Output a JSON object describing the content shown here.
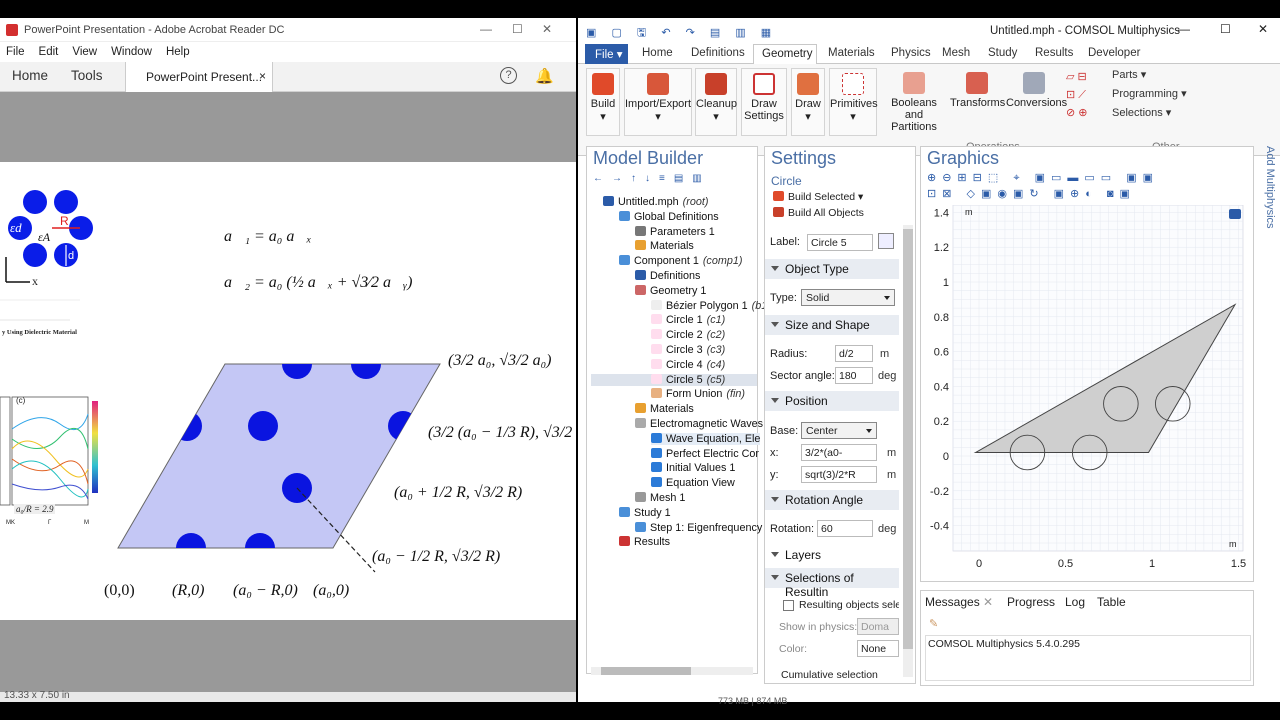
{
  "acrobat": {
    "window_title": "PowerPoint Presentation - Adobe Acrobat Reader DC",
    "menu": [
      "File",
      "Edit",
      "View",
      "Window",
      "Help"
    ],
    "nav": {
      "home": "Home",
      "tools": "Tools",
      "doc_tab": "PowerPoint Present...",
      "close": "×"
    },
    "slide": {
      "eq1": "a⃗₁ = a₀ a⃗ₓ",
      "eq2": "a⃗₂ = a₀ (½ a⃗ₓ + √3⁄2 a⃗ᵧ)",
      "label_top_right": "(3/2 a₀, √3/2 a₀)",
      "label_mid_right": "(3/2 (a₀ − 1/3 R), √3/2 (a₀",
      "label_center_right": "(a₀ + 1/2 R, √3/2 R)",
      "label_lower_right": "(a₀ − 1/2 R, √3/2 R)",
      "bottom_labels": [
        "(0,0)",
        "(R,0)",
        "(a₀ − R,0)",
        "(a₀,0)"
      ],
      "thumb_eps_d": "εd",
      "thumb_eps_a": "εA",
      "thumb_R": "R",
      "thumb_d": "d",
      "thumb_x": "x",
      "thumb_caption": "y Using Dielectric Material",
      "thumb_band_label": "(c)",
      "thumb_ratio": "a₀/R = 2.9",
      "thumb_axis": [
        "MK",
        "Γ",
        "M"
      ]
    },
    "status": "13.33 x 7.50 in"
  },
  "comsol": {
    "window_title": "Untitled.mph - COMSOL Multiphysics",
    "tabs": [
      "File ▾",
      "Home",
      "Definitions",
      "Geometry",
      "Materials",
      "Physics",
      "Mesh",
      "Study",
      "Results",
      "Developer"
    ],
    "ribbon": {
      "build": "Build",
      "import_export": "Import/Export",
      "cleanup": "Cleanup",
      "draw_settings": "Draw Settings",
      "draw": "Draw",
      "primitives": "Primitives",
      "booleans": "Booleans and Partitions",
      "transforms": "Transforms",
      "conversions": "Conversions",
      "operations": "Operations",
      "parts": "Parts ▾",
      "programming": "Programming ▾",
      "selections": "Selections ▾",
      "other": "Other"
    },
    "model_builder": {
      "title": "Model Builder",
      "items": [
        {
          "label": "Untitled.mph",
          "tag": "(root)"
        },
        {
          "label": "Global Definitions",
          "tag": ""
        },
        {
          "label": "Parameters 1",
          "tag": ""
        },
        {
          "label": "Materials",
          "tag": ""
        },
        {
          "label": "Component 1",
          "tag": "(comp1)"
        },
        {
          "label": "Definitions",
          "tag": ""
        },
        {
          "label": "Geometry 1",
          "tag": ""
        },
        {
          "label": "Bézier Polygon 1",
          "tag": "(b1)"
        },
        {
          "label": "Circle 1",
          "tag": "(c1)"
        },
        {
          "label": "Circle 2",
          "tag": "(c2)"
        },
        {
          "label": "Circle 3",
          "tag": "(c3)"
        },
        {
          "label": "Circle 4",
          "tag": "(c4)"
        },
        {
          "label": "Circle 5",
          "tag": "(c5)"
        },
        {
          "label": "Form Union",
          "tag": "(fin)"
        },
        {
          "label": "Materials",
          "tag": ""
        },
        {
          "label": "Electromagnetic Waves",
          "tag": ""
        },
        {
          "label": "Wave Equation, Ele",
          "tag": ""
        },
        {
          "label": "Perfect Electric Cor",
          "tag": ""
        },
        {
          "label": "Initial Values 1",
          "tag": ""
        },
        {
          "label": "Equation View",
          "tag": ""
        },
        {
          "label": "Mesh 1",
          "tag": ""
        },
        {
          "label": "Study 1",
          "tag": ""
        },
        {
          "label": "Step 1: Eigenfrequency",
          "tag": ""
        },
        {
          "label": "Results",
          "tag": ""
        }
      ]
    },
    "settings": {
      "title": "Settings",
      "subtitle": "Circle",
      "build_selected": "Build Selected ▾",
      "build_all": "Build All Objects",
      "label_label": "Label:",
      "label_value": "Circle 5",
      "object_type": "Object Type",
      "type_label": "Type:",
      "type_value": "Solid",
      "size_shape": "Size and Shape",
      "radius_label": "Radius:",
      "radius_value": "d/2",
      "radius_unit": "m",
      "sector_label": "Sector angle:",
      "sector_value": "180",
      "sector_unit": "deg",
      "position": "Position",
      "base_label": "Base:",
      "base_value": "Center",
      "x_label": "x:",
      "x_value": "3/2*(a0-",
      "x_unit": "m",
      "y_label": "y:",
      "y_value": "sqrt(3)/2*R",
      "y_unit": "m",
      "rotation_angle": "Rotation Angle",
      "rotation_label": "Rotation:",
      "rotation_value": "60",
      "rotation_unit": "deg",
      "layers": "Layers",
      "selections_result": "Selections of Resultin",
      "resulting_objects": "Resulting objects selec",
      "show_in_physics": "Show in physics:",
      "show_in_physics_value": "Doma",
      "color_label": "Color:",
      "color_value": "None",
      "cumulative": "Cumulative selection"
    },
    "graphics": {
      "title": "Graphics",
      "y_ticks": [
        "1.4",
        "1.2",
        "1",
        "0.8",
        "0.6",
        "0.4",
        "0.2",
        "0",
        "-0.2",
        "-0.4"
      ],
      "x_ticks": [
        "0",
        "0.5",
        "1",
        "1.5"
      ],
      "unit_m": "m"
    },
    "messages": {
      "tabs": [
        "Messages",
        "Progress",
        "Log",
        "Table"
      ],
      "text": "COMSOL Multiphysics 5.4.0.295"
    },
    "side_label": "Add Multiphysics",
    "status_bar": "773 MB | 874 MB"
  }
}
